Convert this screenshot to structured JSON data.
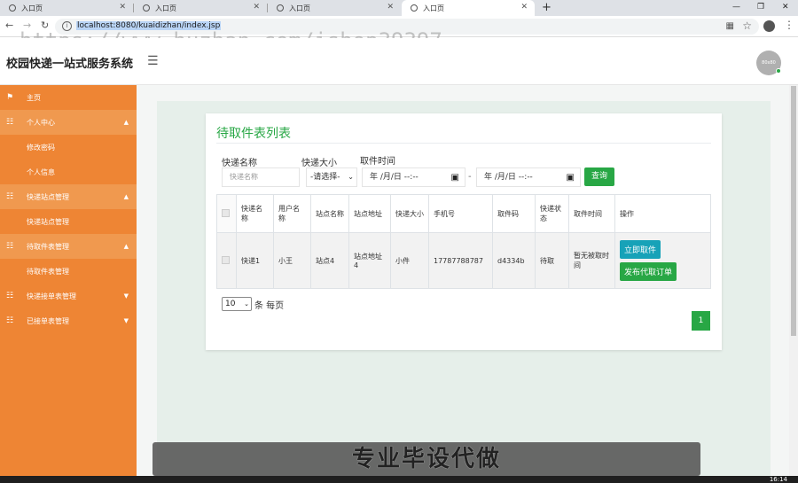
{
  "browser": {
    "tabs": [
      {
        "title": "入口页"
      },
      {
        "title": "入口页"
      },
      {
        "title": "入口页"
      },
      {
        "title": "入口页"
      }
    ],
    "new_tab": "+",
    "url": "localhost:8080/kuaidizhan/index.jsp"
  },
  "watermark": "https://www.huzhan.com/ishop39397",
  "header": {
    "title": "校园快递一站式服务系统",
    "avatar_text": "80x80"
  },
  "sidebar": {
    "items": [
      {
        "label": "主页",
        "icon": "flag-icon",
        "type": "header",
        "caret": ""
      },
      {
        "label": "个人中心",
        "icon": "grid-icon",
        "type": "header",
        "caret": "▲"
      },
      {
        "label": "修改密码",
        "type": "sub"
      },
      {
        "label": "个人信息",
        "type": "sub"
      },
      {
        "label": "快递站点管理",
        "icon": "grid-icon",
        "type": "header",
        "caret": "▲"
      },
      {
        "label": "快递站点管理",
        "type": "sub"
      },
      {
        "label": "待取件表管理",
        "icon": "grid-icon",
        "type": "header",
        "caret": "▲"
      },
      {
        "label": "待取件表管理",
        "type": "sub"
      },
      {
        "label": "快递接单表管理",
        "icon": "grid-icon",
        "type": "header",
        "caret": "▼"
      },
      {
        "label": "已接单表管理",
        "icon": "grid-icon",
        "type": "header",
        "caret": "▼"
      }
    ]
  },
  "card": {
    "title": "待取件表列表",
    "filters": {
      "name_label": "快递名称",
      "name_placeholder": "快递名称",
      "size_label": "快递大小",
      "size_selected": "-请选择-",
      "time_label": "取件时间",
      "date_from": "年 /月/日 --:--",
      "date_to": "年 /月/日 --:--",
      "date_sep": "-",
      "query_button": "查询"
    },
    "table": {
      "columns": [
        "快递名称",
        "用户名称",
        "站点名称",
        "站点地址",
        "快递大小",
        "手机号",
        "取件码",
        "快递状态",
        "取件时间",
        "操作"
      ],
      "rows": [
        {
          "name": "快递1",
          "user": "小王",
          "site": "站点4",
          "address": "站点地址4",
          "size": "小件",
          "phone": "17787788787",
          "code": "d4334b",
          "status": "待取",
          "time": "暂无被取时间",
          "actions": [
            "立即取件",
            "发布代取订单"
          ]
        }
      ]
    },
    "pagination": {
      "page_size": "10",
      "per_page_label": "条 每页",
      "current_page": "1"
    }
  },
  "banner": {
    "text": "专业毕设代做"
  },
  "taskbar": {
    "time": "16:14"
  },
  "colors": {
    "sidebar": "#ee8534",
    "sidebar_header": "#f0994f",
    "accent_green": "#28a745",
    "accent_blue": "#17a2b8"
  }
}
